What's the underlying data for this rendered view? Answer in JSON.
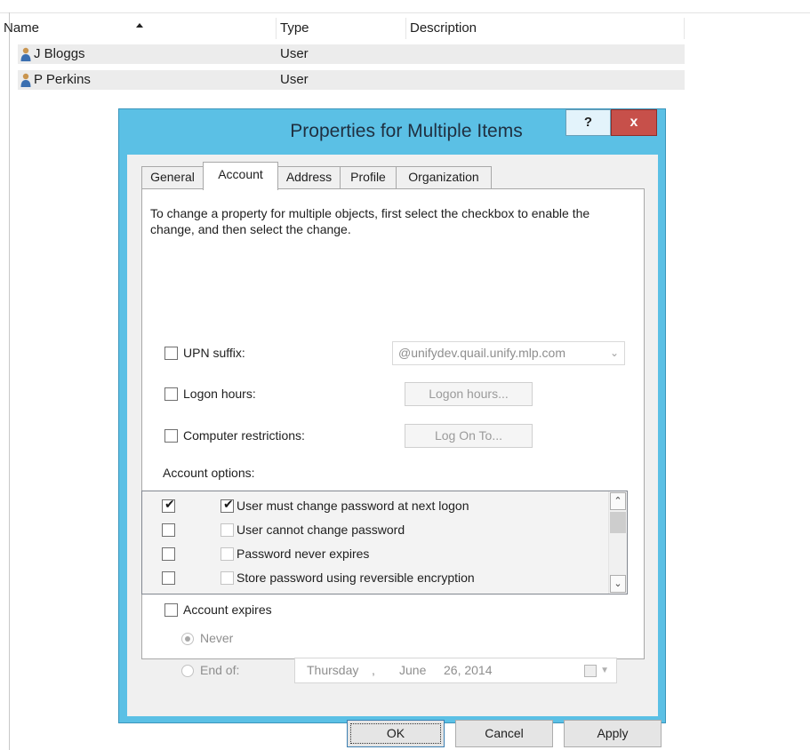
{
  "list": {
    "columns": [
      "Name",
      "Type",
      "Description"
    ],
    "rows": [
      {
        "name": "J Bloggs",
        "type": "User"
      },
      {
        "name": "P Perkins",
        "type": "User"
      }
    ]
  },
  "dialog": {
    "title": "Properties for Multiple Items",
    "help_label": "?",
    "close_label": "x",
    "tabs": [
      "General",
      "Account",
      "Address",
      "Profile",
      "Organization"
    ],
    "active_tab": "Account",
    "intro": "To change a property for multiple objects, first select the checkbox to enable the change, and then select the change.",
    "upn": {
      "label": "UPN suffix:",
      "value": "@unifydev.quail.unify.mlp.com",
      "checked": false
    },
    "logon_hours": {
      "label": "Logon hours:",
      "button": "Logon hours...",
      "checked": false
    },
    "computer_restrictions": {
      "label": "Computer restrictions:",
      "button": "Log On To...",
      "checked": false
    },
    "account_options_label": "Account options:",
    "account_options": [
      {
        "label": "User must change password at next logon",
        "enable_checked": true,
        "value_checked": true
      },
      {
        "label": "User cannot change password",
        "enable_checked": false,
        "value_checked": false
      },
      {
        "label": "Password never expires",
        "enable_checked": false,
        "value_checked": false
      },
      {
        "label": "Store password using reversible encryption",
        "enable_checked": false,
        "value_checked": false
      }
    ],
    "account_expires": {
      "label": "Account expires",
      "checked": false
    },
    "never_label": "Never",
    "end_of_label": "End of:",
    "date": {
      "weekday": "Thursday",
      "month": "June",
      "day_year": "26, 2014"
    },
    "buttons": {
      "ok": "OK",
      "cancel": "Cancel",
      "apply": "Apply"
    }
  },
  "colors": {
    "title_bar": "#5bc0e5",
    "close_button": "#c7504a"
  },
  "icons": {
    "user": "user-icon",
    "calendar": "calendar-icon"
  }
}
